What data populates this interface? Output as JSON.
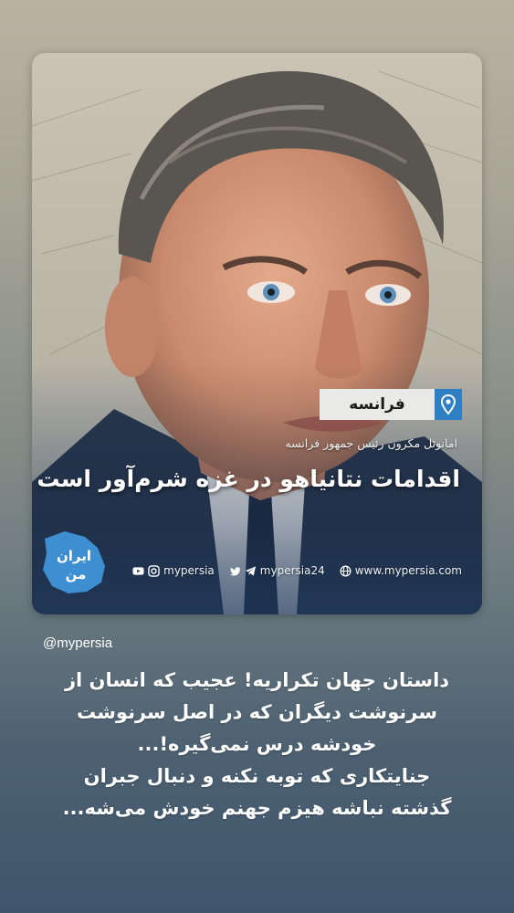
{
  "post": {
    "location": "فرانسه",
    "subtitle": "امانوئل مکرون رئیس جمهور فرانسه",
    "headline": "اقدامات نتانیاهو در غزه شرم‌آور است",
    "logo_text": "ایران من",
    "socials": {
      "youtube_instagram_handle": "mypersia",
      "twitter_telegram_handle": "mypersia24",
      "website": "www.mypersia.com"
    }
  },
  "story": {
    "handle": "@mypersia",
    "caption_lines": [
      "داستان جهان تکراریه! عجیب که انسان از",
      "سرنوشت دیگران که در اصل سرنوشت",
      "خودشه درس نمی‌گیره!...",
      "جنایتکاری که توبه نکنه و دنبال جبران",
      "گذشته نباشه هیزم جهنم خودش می‌شه..."
    ]
  },
  "colors": {
    "pin_blue": "#2f7fc4",
    "background_top": "#b9b2a1",
    "background_bottom": "#3e556b"
  }
}
